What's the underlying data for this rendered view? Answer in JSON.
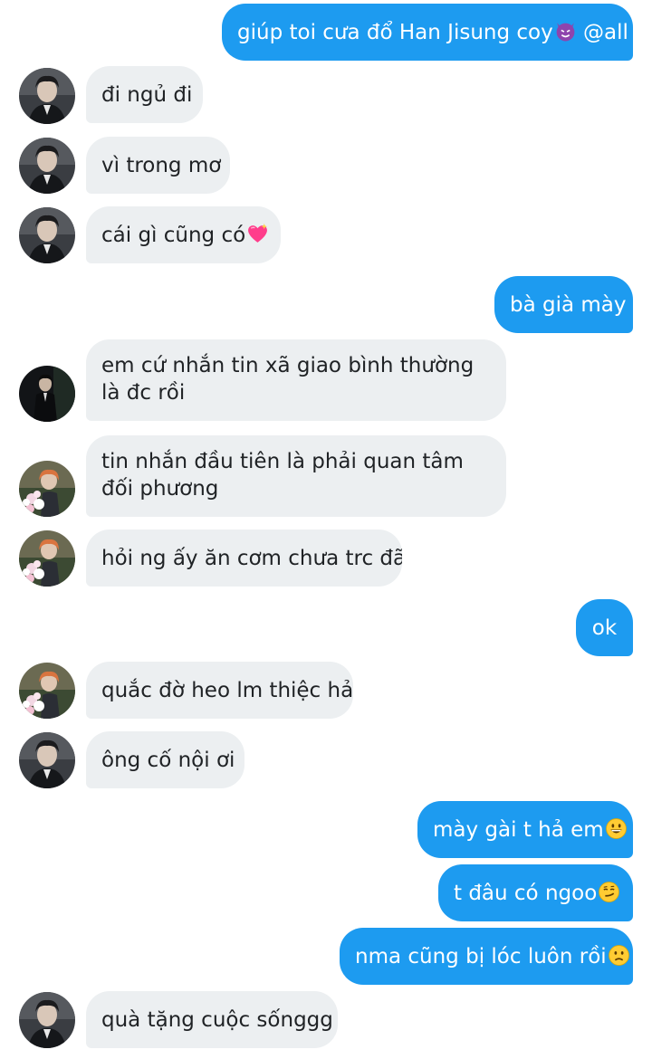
{
  "messages": [
    {
      "side": "sent",
      "text": "giúp toi cưa đổ Han Jisung coy",
      "emoji": "smiling-imp",
      "suffix": " @all"
    },
    {
      "side": "recv",
      "avatar": "dark",
      "text": "đi ngủ đi"
    },
    {
      "side": "recv",
      "avatar": "dark",
      "text": "vì trong mơ"
    },
    {
      "side": "recv",
      "avatar": "dark",
      "text": "cái gì cũng có",
      "emoji": "sparkling-heart"
    },
    {
      "side": "sent",
      "text": "bà già mày"
    },
    {
      "side": "recv",
      "avatar": "suit",
      "text": "em cứ nhắn tin xã giao bình thường là đc rồi"
    },
    {
      "side": "recv",
      "avatar": "flowers",
      "text": "tin nhắn đầu tiên là phải quan tâm đối phương"
    },
    {
      "side": "recv",
      "avatar": "flowers",
      "text": "hỏi ng ấy ăn cơm chưa trc đã"
    },
    {
      "side": "sent",
      "text": "ok"
    },
    {
      "side": "recv",
      "avatar": "flowers",
      "text": "quắc đờ heo lm thiệc hả"
    },
    {
      "side": "recv",
      "avatar": "dark",
      "text": "ông cố nội ơi"
    },
    {
      "side": "sent",
      "text": "mày gài t hả em",
      "emoji": "grinning-face"
    },
    {
      "side": "sent",
      "text": "t đâu có ngoo",
      "emoji": "smirking-face"
    },
    {
      "side": "sent",
      "text": "nma cũng bị lóc luôn rồi",
      "emoji": "slightly-frowning-face"
    },
    {
      "side": "recv",
      "avatar": "dark",
      "text": "quà tặng cuộc sốnggg"
    }
  ],
  "colors": {
    "sent_bubble": "#1d9bf0",
    "sent_text": "#ffffff",
    "recv_bubble": "#eceff1",
    "recv_text": "#1f2225",
    "background": "#ffffff"
  }
}
